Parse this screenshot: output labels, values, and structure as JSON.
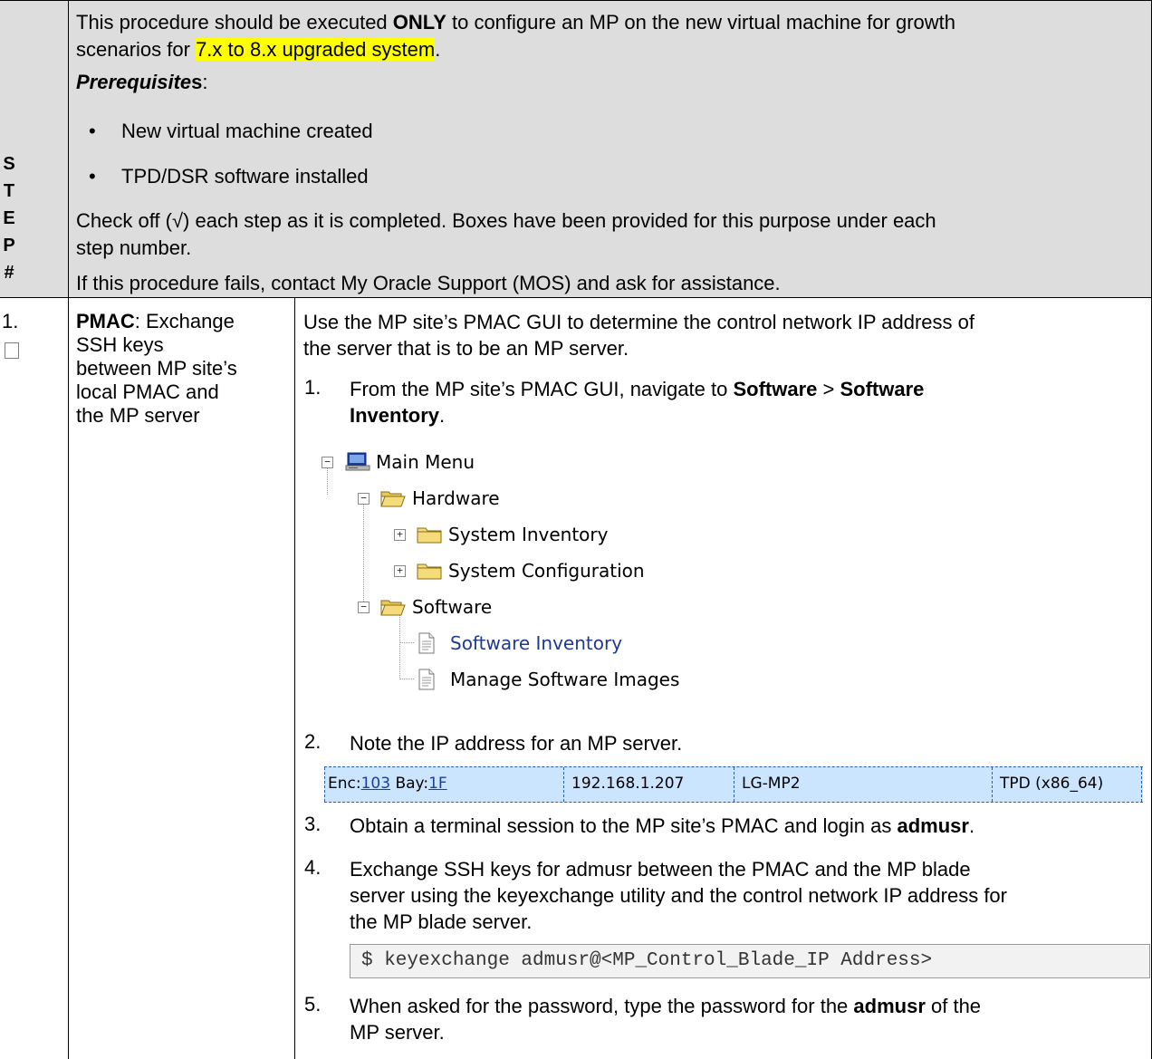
{
  "step_label": [
    "S",
    "T",
    "E",
    "P",
    "#"
  ],
  "header": {
    "line1_pre": "This procedure should be executed ",
    "line1_bold": "ONLY",
    "line1_post": " to configure an MP on the new virtual machine for growth",
    "line2_pre": "scenarios for ",
    "line2_highlight": "7.x to 8.x upgraded system",
    "line2_post": ".",
    "prereq_label": "Prerequisite",
    "prereq_s": "s",
    "prereq_colon": ":",
    "bullets": [
      "New virtual machine created",
      "TPD/DSR software installed"
    ],
    "checkoff_line1": "Check off (√) each step as it is completed.  Boxes have been provided for this purpose under each",
    "checkoff_line2": "step number.",
    "fail_line": "If this procedure fails, contact My Oracle Support (MOS) and ask for assistance."
  },
  "step": {
    "number": "1.",
    "title_bold": "PMAC",
    "title_rest_1": ":  Exchange",
    "title_rest_lines": [
      "SSH keys",
      "between MP site’s",
      "local PMAC and",
      "the MP server"
    ],
    "intro_1": "Use the MP site’s PMAC GUI to determine the control network IP address of",
    "intro_2": "the server that is to be an MP server.",
    "items": {
      "i1_num": "1.",
      "i1_pre": "From the MP site’s PMAC GUI, navigate to ",
      "i1_b1": "Software",
      "i1_mid": " > ",
      "i1_b2": "Software",
      "i1_b3": "Inventory",
      "i1_end": ".",
      "i2_num": "2.",
      "i2_text": "Note the IP address for an MP server.",
      "i3_num": "3.",
      "i3_pre": "Obtain a terminal session to the MP site’s PMAC and login as ",
      "i3_bold": "admusr",
      "i3_end": ".",
      "i4_num": "4.",
      "i4_line1": "Exchange SSH keys for admusr between the PMAC and the MP blade",
      "i4_line2": "server using the keyexchange utility and the control network IP address for",
      "i4_line3": "the MP blade server.",
      "i5_num": "5.",
      "i5_pre": "When asked for the password, type the password for the ",
      "i5_bold": "admusr",
      "i5_post": " of the",
      "i5_line2": "MP server."
    },
    "tree": {
      "main_menu": "Main Menu",
      "hardware": "Hardware",
      "system_inventory": "System Inventory",
      "system_configuration": "System Configuration",
      "software": "Software",
      "software_inventory": "Software Inventory",
      "manage_software_images": "Manage Software Images"
    },
    "server_row": {
      "enc_label": "Enc:",
      "enc_value": "103",
      "bay_label": "Bay:",
      "bay_value": "1F",
      "ip": "192.168.1.207",
      "hostname": "LG-MP2",
      "os": "TPD (x86_64)"
    },
    "command": "$ keyexchange admusr@<MP_Control_Blade_IP Address>"
  }
}
